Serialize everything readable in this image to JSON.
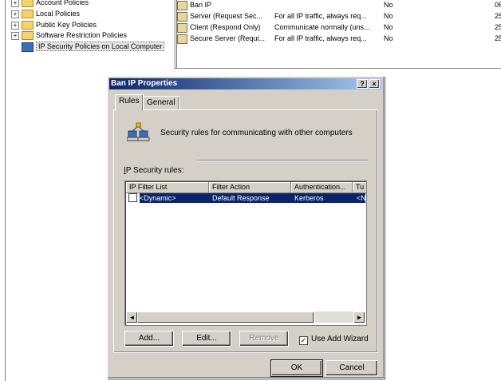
{
  "tree": {
    "items": [
      {
        "label": "Account Policies",
        "expander": "+"
      },
      {
        "label": "Local Policies",
        "expander": "+"
      },
      {
        "label": "Public Key Policies",
        "expander": "+"
      },
      {
        "label": "Software Restriction Policies",
        "expander": "+"
      },
      {
        "label": "IP Security Policies on Local Computer",
        "expander": ""
      }
    ]
  },
  "policy_list": {
    "rows": [
      {
        "name": "Ban IP",
        "description": "",
        "assigned": "No",
        "extra": "06"
      },
      {
        "name": "Server (Request Sec...",
        "description": "For all IP traffic, always req...",
        "assigned": "No",
        "extra": "25"
      },
      {
        "name": "Client (Respond Only)",
        "description": "Communicate normally (uns...",
        "assigned": "No",
        "extra": "25"
      },
      {
        "name": "Secure Server (Requi...",
        "description": "For all IP traffic, always req...",
        "assigned": "No",
        "extra": "25"
      }
    ]
  },
  "dialog": {
    "title": "Ban IP  Properties",
    "help_label": "?",
    "close_label": "×",
    "tabs": [
      {
        "label": "Rules"
      },
      {
        "label": "General"
      }
    ],
    "description": "Security rules for communicating with other computers",
    "rules_label": "IP Security rules:",
    "columns": [
      "IP Filter List",
      "Filter Action",
      "Authentication...",
      "Tu"
    ],
    "rules": [
      {
        "checked": false,
        "filter_list": "<Dynamic>",
        "filter_action": "Default Response",
        "authentication": "Kerberos",
        "tunnel": "<N"
      }
    ],
    "scroll_left": "◄",
    "scroll_right": "►",
    "buttons": {
      "add": "Add...",
      "edit": "Edit...",
      "remove": "Remove",
      "ok": "OK",
      "cancel": "Cancel"
    },
    "use_wizard": {
      "label": "Use Add Wizard",
      "checked": true,
      "mark": "✓"
    }
  }
}
